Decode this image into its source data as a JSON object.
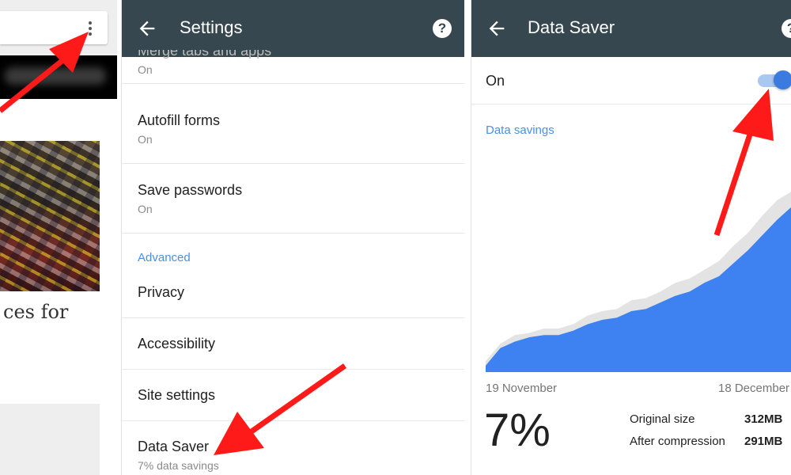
{
  "browser": {
    "menu_icon": "more-vert-icon",
    "article_text": "ces for",
    "accent": "#ff0000"
  },
  "settings": {
    "title": "Settings",
    "back_icon": "arrow-back-icon",
    "help_icon": "help-icon",
    "help_glyph": "?",
    "partial_item": {
      "subtitle": "On"
    },
    "items": [
      {
        "title": "Autofill forms",
        "subtitle": "On"
      },
      {
        "title": "Save passwords",
        "subtitle": "On"
      }
    ],
    "section_advanced": "Advanced",
    "advanced_items": [
      {
        "title": "Privacy"
      },
      {
        "title": "Accessibility"
      },
      {
        "title": "Site settings"
      },
      {
        "title": "Data Saver",
        "subtitle": "7% data savings"
      }
    ],
    "appbar_color": "#37474f"
  },
  "data_saver": {
    "title": "Data Saver",
    "back_icon": "arrow-back-icon",
    "help_icon": "help-icon",
    "help_glyph": "?",
    "toggle_label": "On",
    "toggle_on": true,
    "savings_heading": "Data savings",
    "date_start": "19 November",
    "date_end": "18 December",
    "percent": "7%",
    "original_label": "Original size",
    "original_value": "312MB",
    "compressed_label": "After compression",
    "compressed_value": "291MB",
    "accent": "#3b7be0"
  },
  "chart_data": {
    "type": "area",
    "title": "",
    "xlabel": "",
    "ylabel": "",
    "x": [
      "19 November",
      "18 December"
    ],
    "ylim": [
      0,
      1
    ],
    "series": [
      {
        "values": [
          0.05,
          0.13,
          0.17,
          0.18,
          0.2,
          0.2,
          0.22,
          0.26,
          0.28,
          0.29,
          0.33,
          0.34,
          0.37,
          0.41,
          0.43,
          0.47,
          0.51,
          0.58,
          0.64,
          0.72,
          0.79,
          0.83
        ]
      },
      {
        "values": [
          0.03,
          0.11,
          0.14,
          0.16,
          0.17,
          0.17,
          0.19,
          0.22,
          0.24,
          0.25,
          0.28,
          0.29,
          0.32,
          0.35,
          0.37,
          0.41,
          0.44,
          0.5,
          0.56,
          0.63,
          0.7,
          0.76
        ]
      }
    ],
    "grid": false,
    "legend": "none"
  }
}
